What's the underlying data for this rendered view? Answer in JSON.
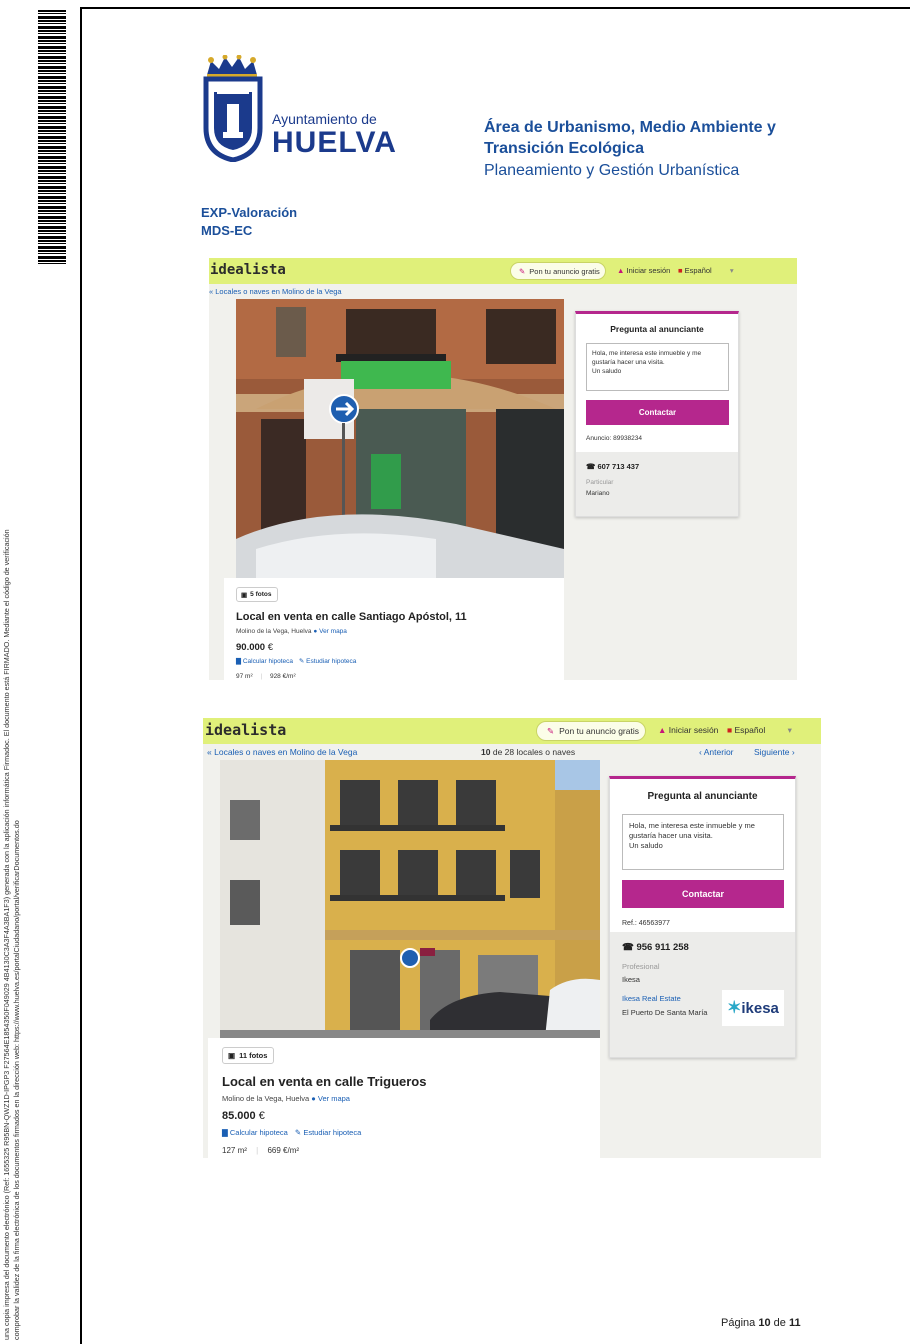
{
  "sidebar": {
    "line1": "una copia impresa del documento electrónico (Ref: 1655325 R95BN-QWZ1D-IPGP3 F27564E1854350F049029 4B4130C3A3F4A3BA1F3) generada con la aplicación informática Firmadoc. El documento está FIRMADO. Mediante el código de verificación",
    "line2": "comprobar la validez de la firma electrónica de los documentos firmados en la dirección web: https://www.huelva.es/portalCiudadano/portal/verificarDocumentos.do"
  },
  "header": {
    "ayuntamiento": "Ayuntamiento de",
    "huelva": "HUELVA",
    "area_line1": "Área de Urbanismo, Medio Ambiente y",
    "area_line2": "Transición Ecológica",
    "planeamiento": "Planeamiento y Gestión Urbanística",
    "exp": "EXP-Valoración",
    "mds": "MDS-EC"
  },
  "colors": {
    "brand_blue": "#1b4f9a",
    "idealista_green": "#e0f07a",
    "accent_magenta": "#b5278d"
  },
  "screenshot1": {
    "brand": "idealista",
    "pon_anuncio": "Pon tu anuncio gratis",
    "iniciar": "Iniciar sesión",
    "idioma": "Español",
    "breadcrumb": "Locales o naves en Molino de la Vega",
    "contact_title": "Pregunta al anunciante",
    "message": "Hola, me interesa este inmueble y me gustaría hacer una visita.\nUn saludo",
    "contact_button": "Contactar",
    "ref": "Anuncio: 89938234",
    "phone": "607 713 437",
    "advertiser_type": "Particular",
    "advertiser_name": "Mariano",
    "photos_badge": "5 fotos",
    "title": "Local en venta en calle Santiago Apóstol, 11",
    "location": "Molino de la Vega, Huelva",
    "map_link": "Ver mapa",
    "price": "90.000",
    "currency": "€",
    "calc": "Calcular hipoteca",
    "estudiar": "Estudiar hipoteca",
    "area": "97 m²",
    "price_m2": "928 €/m²"
  },
  "screenshot2": {
    "brand": "idealista",
    "pon_anuncio": "Pon tu anuncio gratis",
    "iniciar": "Iniciar sesión",
    "idioma": "Español",
    "breadcrumb": "Locales o naves en Molino de la Vega",
    "counter_num": "10",
    "counter_rest": "de 28 locales o naves",
    "anterior": "Anterior",
    "siguiente": "Siguiente",
    "contact_title": "Pregunta al anunciante",
    "message": "Hola, me interesa este inmueble y me gustaría hacer una visita.\nUn saludo",
    "contact_button": "Contactar",
    "ref": "Ref.: 46563977",
    "phone": "956 911 258",
    "advertiser_type": "Profesional",
    "advertiser_name": "Ikesa",
    "agency_link": "Ikesa Real Estate",
    "agency_city": "El Puerto De Santa María",
    "agency_logo": "ikesa",
    "photos_badge": "11 fotos",
    "title": "Local en venta en calle Trigueros",
    "location": "Molino de la Vega, Huelva",
    "map_link": "Ver mapa",
    "price": "85.000",
    "currency": "€",
    "calc": "Calcular hipoteca",
    "estudiar": "Estudiar hipoteca",
    "area": "127 m²",
    "price_m2": "669 €/m²"
  },
  "footer": {
    "pagina": "Página",
    "page": "10",
    "de": "de",
    "total": "11"
  }
}
